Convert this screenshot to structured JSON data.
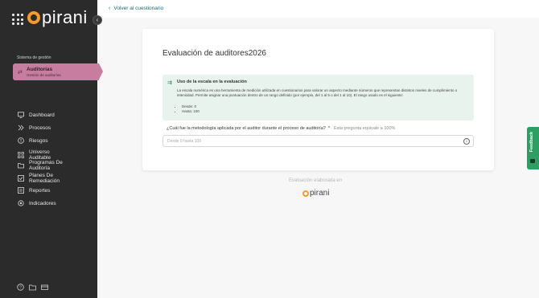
{
  "app": {
    "logo_text": "pirani",
    "brand_color": "#f59a2b"
  },
  "sidebar": {
    "section_label": "Sistema de gestión",
    "active_module": {
      "title": "Auditorías",
      "subtitle": "Gestión de auditorías",
      "icon": "audit-icon",
      "color": "#c77da0"
    },
    "items": [
      {
        "label": "Dashboard",
        "icon": "monitor-icon"
      },
      {
        "label": "Procesos",
        "icon": "process-icon"
      },
      {
        "label": "Riesgos",
        "icon": "warning-icon"
      },
      {
        "label": "Universo Auditable",
        "icon": "grid-icon"
      },
      {
        "label": "Programas De Auditoría",
        "icon": "folder-program-icon"
      },
      {
        "label": "Planes De Remediación",
        "icon": "checkbox-icon"
      },
      {
        "label": "Reportes",
        "icon": "report-icon"
      },
      {
        "label": "Indicadores",
        "icon": "target-icon"
      }
    ],
    "bottom_icons": [
      "help-icon",
      "folder-icon",
      "card-icon"
    ]
  },
  "header": {
    "back_label": "Volver al cuestionario"
  },
  "form": {
    "title": "Evaluación de auditores2026",
    "info": {
      "title": "Uso de la escala en la evaluación",
      "text": "La escala numérica es una herramienta de medición utilizada en cuestionarios para valorar un aspecto mediante números que representan distintos niveles de cumplimiento o intensidad. Permite asignar una puntuación dentro de un rango definido (por ejemplo, del 1 al 5 o del 1 al 10). El rango usado es el siguiente:",
      "range_from": "Desde: 0",
      "range_to": "Hasta: 100"
    },
    "question": {
      "text": "¿Cuál fue la metodología aplicada por el auditor durante el proceso de auditoría?",
      "required_mark": "*",
      "weight_hint": "Esta pregunta equivale a 100%",
      "placeholder": "Desde 0 hasta 100",
      "value": ""
    }
  },
  "footer": {
    "made_in": "Evaluación elaborada en",
    "logo_text": "pirani"
  },
  "feedback": {
    "label": "Feedback",
    "color": "#2e9e63"
  }
}
